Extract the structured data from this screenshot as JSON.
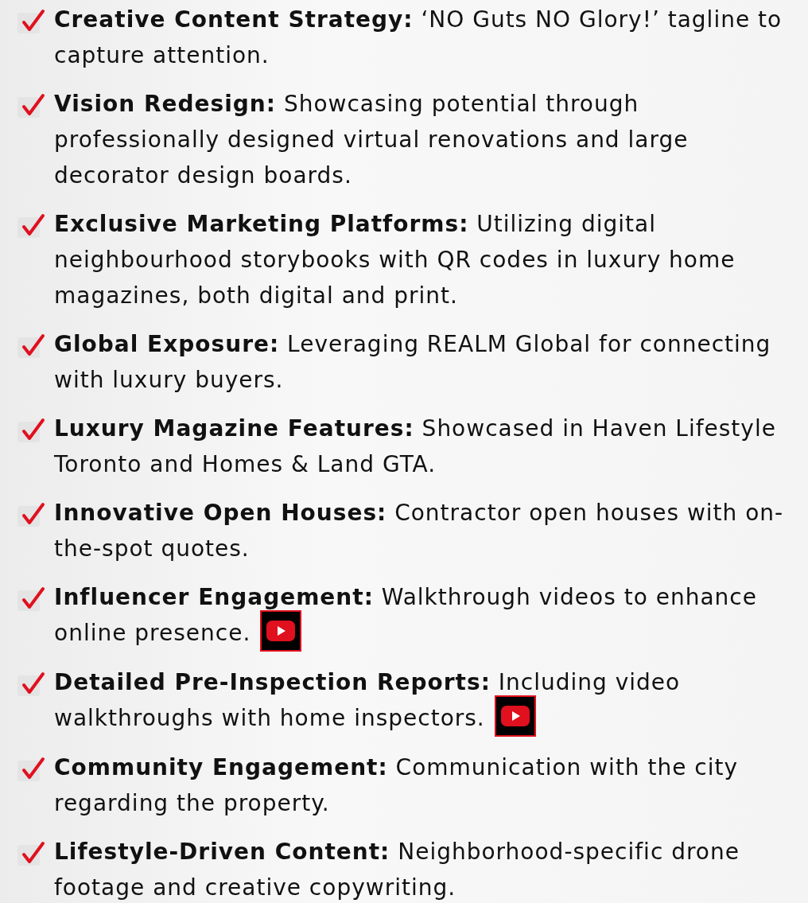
{
  "items": [
    {
      "text": "**Creative Content Strategy:** ‘NO Guts NO Glory!’ tagline to capture attention.",
      "video_link": false
    },
    {
      "text": "**Vision Redesign:** Showcasing potential through professionally designed virtual renovations and large decorator design boards.",
      "video_link": false
    },
    {
      "text": "**Exclusive Marketing Platforms:** Utilizing digital neighbourhood storybooks with QR codes in luxury home magazines, both digital and print.",
      "video_link": false
    },
    {
      "text": "**Global Exposure:** Leveraging REALM Global for connecting with luxury buyers.",
      "video_link": false
    },
    {
      "text": "**Luxury Magazine Features:** Showcased in Haven Lifestyle Toronto and Homes & Land GTA.",
      "video_link": false
    },
    {
      "text": "**Innovative Open Houses:** Contractor open houses with on-the-spot quotes.",
      "video_link": false
    },
    {
      "text": "**Influencer Engagement:** Walkthrough videos to enhance online presence.",
      "video_link": true
    },
    {
      "text": "**Detailed Pre-Inspection Reports:** Including video walkthroughs with home inspectors.",
      "video_link": true
    },
    {
      "text": "**Community Engagement:** Communication with the city regarding the property.",
      "video_link": false
    },
    {
      "text": "**Lifestyle-Driven Content:** Neighborhood-specific drone footage and creative copywriting.",
      "video_link": false
    }
  ]
}
